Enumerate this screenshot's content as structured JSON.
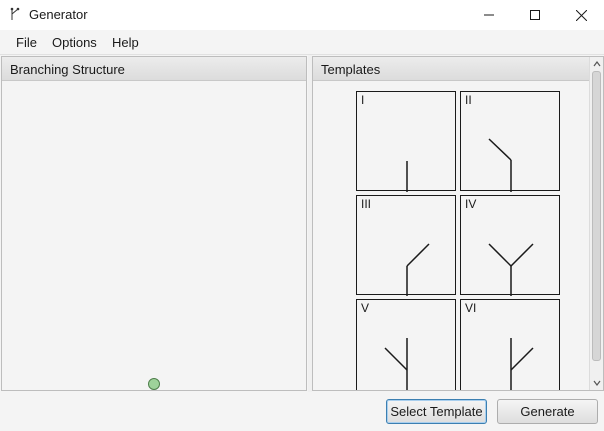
{
  "window": {
    "title": "Generator",
    "icon": "branch-icon",
    "controls": [
      "minimize-icon",
      "maximize-icon",
      "close-icon"
    ]
  },
  "menu": {
    "file": "File",
    "options": "Options",
    "help": "Help"
  },
  "left_panel": {
    "title": "Branching Structure",
    "root_node_color": "#9ed29a"
  },
  "right_panel": {
    "title": "Templates",
    "templates": [
      {
        "label": "I",
        "icon": "template-i-icon"
      },
      {
        "label": "II",
        "icon": "template-ii-icon"
      },
      {
        "label": "III",
        "icon": "template-iii-icon"
      },
      {
        "label": "IV",
        "icon": "template-iv-icon"
      },
      {
        "label": "V",
        "icon": "template-v-icon"
      },
      {
        "label": "VI",
        "icon": "template-vi-icon"
      }
    ]
  },
  "buttons": {
    "select_template": "Select Template",
    "generate": "Generate"
  },
  "colors": {
    "focus_border": "#3c7fb1",
    "background": "#f4f4f4"
  }
}
